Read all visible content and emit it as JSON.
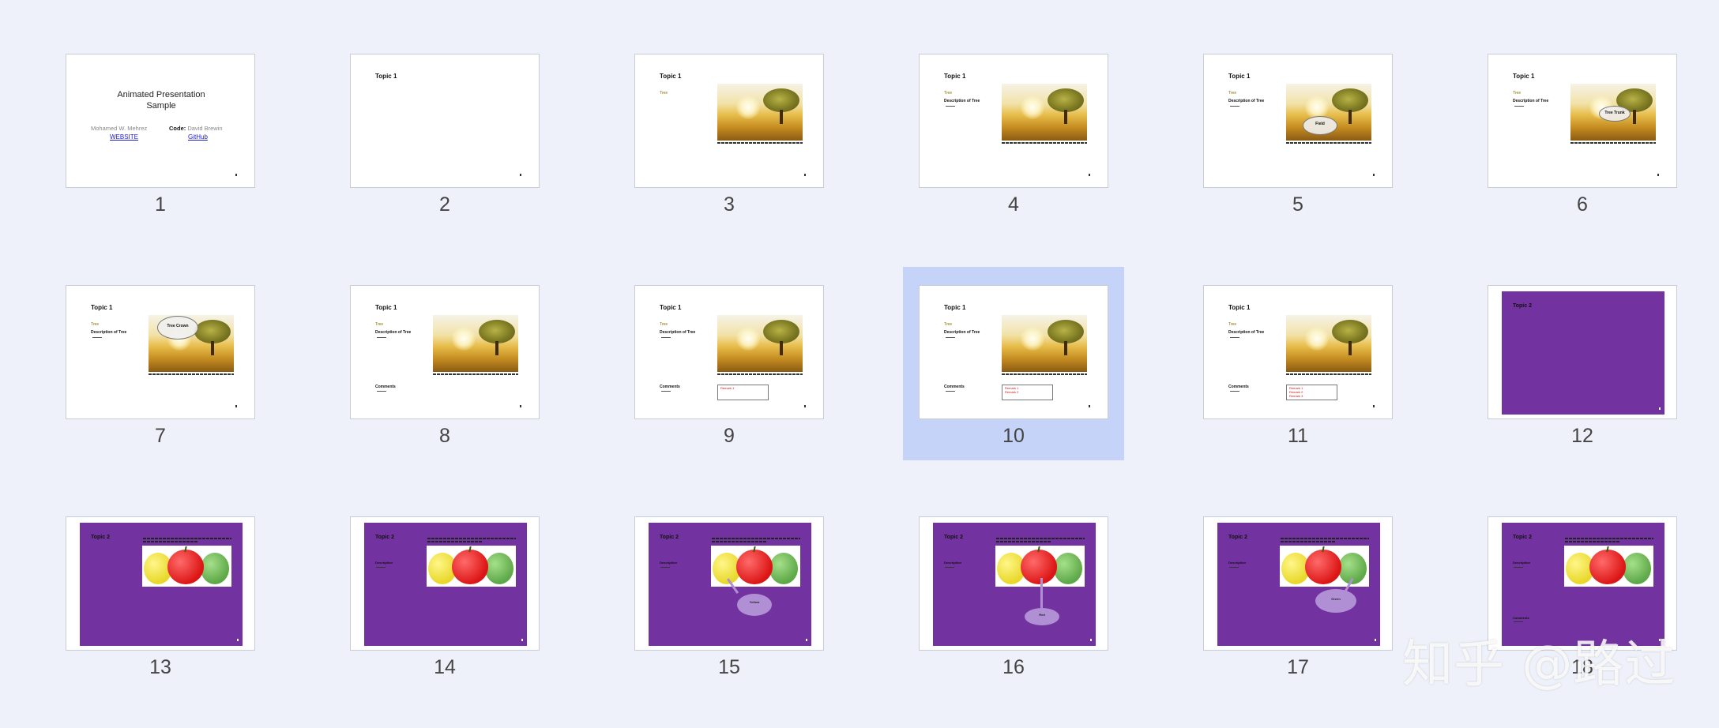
{
  "app": {
    "view": "Slide Sorter"
  },
  "title_slide": {
    "title": "Animated Presentation Sample",
    "author": "Mohamed W. Mehrez",
    "code_label": "Code:",
    "code_name": "David Brewin",
    "link_website": "WEBSITE",
    "link_github": "GitHub"
  },
  "labels": {
    "topic1": "Topic 1",
    "topic2": "Topic 2",
    "tree": "Tree",
    "description_of_tree": "Description of Tree",
    "comments": "Comments",
    "description": "Description",
    "tree_trunk": "Tree Trunk",
    "tree_crown": "Tree Crown",
    "field": "Field",
    "yellow": "Yellow",
    "red": "Red",
    "green": "Green",
    "remark1": "Remark 1",
    "remark2": "Remark 2",
    "remark3": "Remark 3"
  },
  "slides": [
    {
      "number": "1",
      "selected": false
    },
    {
      "number": "2",
      "selected": false
    },
    {
      "number": "3",
      "selected": false
    },
    {
      "number": "4",
      "selected": false
    },
    {
      "number": "5",
      "selected": false
    },
    {
      "number": "6",
      "selected": false
    },
    {
      "number": "7",
      "selected": false
    },
    {
      "number": "8",
      "selected": false
    },
    {
      "number": "9",
      "selected": false
    },
    {
      "number": "10",
      "selected": true
    },
    {
      "number": "11",
      "selected": false
    },
    {
      "number": "12",
      "selected": false
    },
    {
      "number": "13",
      "selected": false
    },
    {
      "number": "14",
      "selected": false
    },
    {
      "number": "15",
      "selected": false
    },
    {
      "number": "16",
      "selected": false
    },
    {
      "number": "17",
      "selected": false
    },
    {
      "number": "18",
      "selected": false
    }
  ],
  "watermark": "知乎 @路过",
  "colors": {
    "purple": "#7232a0",
    "selection": "#c5d3f8",
    "background": "#eef1f9"
  }
}
